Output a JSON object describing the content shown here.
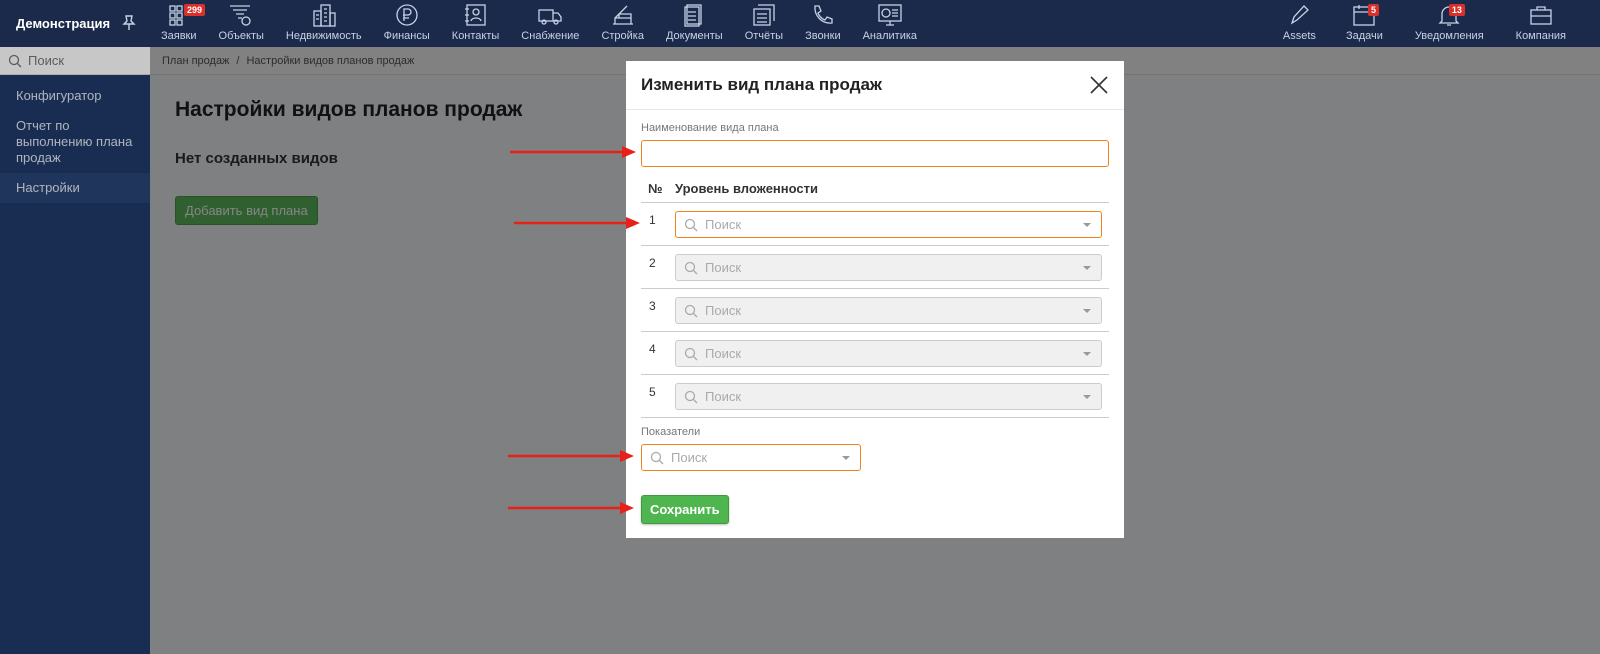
{
  "brand": {
    "title": "Демонстрация",
    "pin_icon": "pin-icon"
  },
  "nav": [
    {
      "label": "Заявки",
      "icon": "grid-icon",
      "badge": "299"
    },
    {
      "label": "Объекты",
      "icon": "filter-icon"
    },
    {
      "label": "Недвижимость",
      "icon": "buildings-icon"
    },
    {
      "label": "Финансы",
      "icon": "ruble-icon"
    },
    {
      "label": "Контакты",
      "icon": "contacts-icon"
    },
    {
      "label": "Снабжение",
      "icon": "truck-icon"
    },
    {
      "label": "Стройка",
      "icon": "construction-icon"
    },
    {
      "label": "Документы",
      "icon": "documents-icon"
    },
    {
      "label": "Отчёты",
      "icon": "reports-icon"
    },
    {
      "label": "Звонки",
      "icon": "phone-icon"
    },
    {
      "label": "Аналитика",
      "icon": "analytics-icon"
    }
  ],
  "nav_right": [
    {
      "label": "Assets",
      "icon": "pencil-icon"
    },
    {
      "label": "Задачи",
      "icon": "calendar-icon",
      "badge": "5"
    },
    {
      "label": "Уведомления",
      "icon": "bell-icon",
      "badge": "13"
    },
    {
      "label": "Компания",
      "icon": "briefcase-icon"
    }
  ],
  "sidebar": {
    "search_placeholder": "Поиск",
    "items": [
      "Конфигуратор",
      "Отчет по выполнению плана продаж",
      "Настройки"
    ],
    "active_index": 2
  },
  "breadcrumb": {
    "items": [
      "План продаж",
      "Настройки видов планов продаж"
    ],
    "separator": "/"
  },
  "page": {
    "title": "Настройки видов планов продаж",
    "empty_text": "Нет созданных видов",
    "add_button": "Добавить вид плана"
  },
  "modal": {
    "title": "Изменить вид плана продаж",
    "name_label": "Наименование вида плана",
    "name_value": "",
    "col_number": "№",
    "col_level": "Уровень вложенности",
    "rows": [
      {
        "num": "1",
        "placeholder": "Поиск"
      },
      {
        "num": "2",
        "placeholder": "Поиск"
      },
      {
        "num": "3",
        "placeholder": "Поиск"
      },
      {
        "num": "4",
        "placeholder": "Поиск"
      },
      {
        "num": "5",
        "placeholder": "Поиск"
      }
    ],
    "indicators_label": "Показатели",
    "indicators_placeholder": "Поиск",
    "save_button": "Сохранить"
  },
  "colors": {
    "topbar": "#1b2a4a",
    "sidebar": "#1f3a68",
    "accent_orange": "#f0821e",
    "button_green": "#4fb64f",
    "arrow_red": "#e8201a"
  }
}
